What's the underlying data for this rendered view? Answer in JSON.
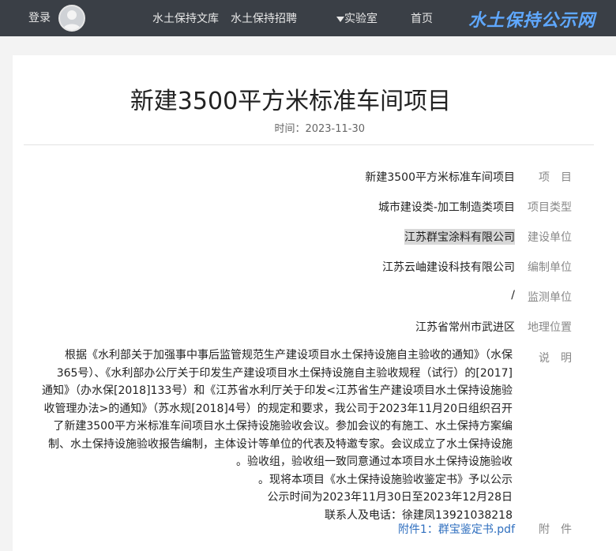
{
  "header": {
    "brand": "水土保持公示网",
    "nav": {
      "home": "首页",
      "lab": "实验室",
      "recruit": "水土保持招聘",
      "docs": "水土保持文库"
    },
    "login": "登录",
    "avatar_icon": "user-avatar-icon"
  },
  "article": {
    "title": "新建3500平方米标准车间项目",
    "date": "时间：2023-11-30",
    "fields": [
      {
        "label": "项　目",
        "value": "新建3500平方米标准车间项目"
      },
      {
        "label": "项目类型",
        "value": "城市建设类-加工制造类项目"
      },
      {
        "label": "建设单位",
        "value": "江苏群宝涂料有限公司"
      },
      {
        "label": "编制单位",
        "value": "江苏云岫建设科技有限公司"
      },
      {
        "label": "监测单位",
        "value": "/"
      },
      {
        "label": "地理位置",
        "value": "江苏省常州市武进区"
      }
    ],
    "description_label": "说　明",
    "description_lines": [
      "根据《水利部关于加强事中事后监管规范生产建设项目水土保持设施自主验收的通知》（水保",
      "[2017]365号）、《水利部办公厅关于印发生产建设项目水土保持设施自主验收规程（试行）的",
      "通知》（办水保[2018]133号）和《江苏省水利厅关于印发<江苏省生产建设项目水土保持设施验",
      "收管理办法>的通知》（苏水规[2018]4号）的规定和要求，我公司于2023年11月20日组织召开",
      "了新建3500平方米标准车间项目水土保持设施验收会议。参加会议的有施工、水土保持方案编",
      "制、水土保持设施验收报告编制，主体设计等单位的代表及特邀专家。会议成立了水土保持设施",
      "验收组，验收组一致同意通过本项目水土保持设施验收。",
      "现将本项目《水土保持设施验收鉴定书》予以公示。",
      "公示时间为2023年11月30日至2023年12月28日",
      "联系人及电话：徐建凤13921038218"
    ],
    "attachment_label": "附　件",
    "attachment_link": "附件1：群宝鉴定书.pdf"
  },
  "colors": {
    "topbar": "#3a3f46",
    "brand": "#5fa8ff",
    "link": "#2f6fbf"
  }
}
